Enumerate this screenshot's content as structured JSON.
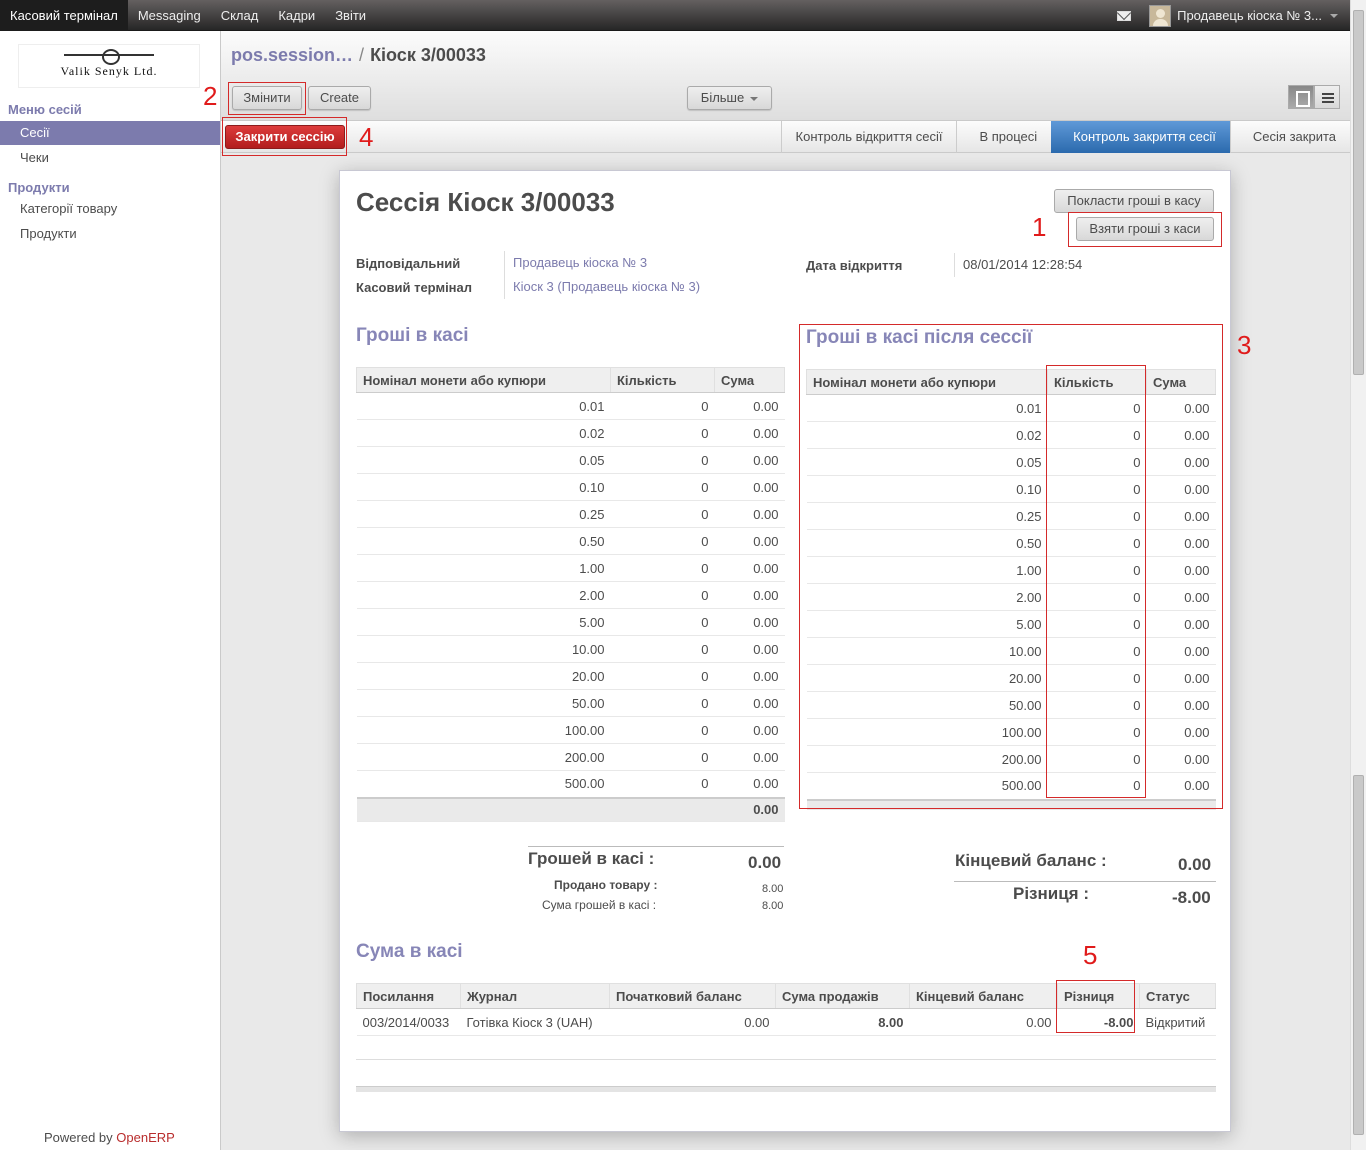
{
  "topbar": {
    "menu": [
      "Касовий термінал",
      "Messaging",
      "Склад",
      "Кадри",
      "Звіти"
    ],
    "user": "Продавець кіоска № 3..."
  },
  "sidebar": {
    "logo_text": "Valik Senyk Ltd.",
    "sessions_head": "Меню сесій",
    "sessions_items": [
      "Сесії",
      "Чеки"
    ],
    "products_head": "Продукти",
    "products_items": [
      "Категорії товару",
      "Продукти"
    ],
    "powered_prefix": "Powered by ",
    "powered_brand": "OpenERP"
  },
  "header": {
    "bc_link": "pos.session…",
    "bc_sep": "/",
    "bc_current": "Кіоск 3/00033",
    "edit_label": "Змінити",
    "create_label": "Create",
    "more_label": "Більше"
  },
  "statusbar": {
    "close_label": "Закрити сессію",
    "stages": [
      "Контроль відкриття сесії",
      "В процесі",
      "Контроль закриття сесії",
      "Сесія закрита"
    ],
    "active_stage": 2
  },
  "sheet": {
    "title": "Сессія Кіоск 3/00033",
    "put_money": "Покласти гроші в касу",
    "take_money": "Взяти гроші з каси",
    "responsible_label": "Відповідальний",
    "responsible_value": "Продавець кіоска № 3",
    "pos_label": "Касовий термінал",
    "pos_value": "Кіоск 3 (Продавець кіоска № 3)",
    "open_date_label": "Дата відкриття",
    "open_date_value": "08/01/2014 12:28:54",
    "cash_title": "Гроші в касі",
    "cash_after_title": "Гроші в касі після сессії",
    "col_denom": "Номінал монети або купюри",
    "col_qty": "Кількість",
    "col_sum": "Сума",
    "denoms": [
      "0.01",
      "0.02",
      "0.05",
      "0.10",
      "0.25",
      "0.50",
      "1.00",
      "2.00",
      "5.00",
      "10.00",
      "20.00",
      "50.00",
      "100.00",
      "200.00",
      "500.00"
    ],
    "qty": "0",
    "sum": "0.00",
    "total": "0.00",
    "money_in_cash_label": "Грошей в касі :",
    "money_in_cash_value": "0.00",
    "sold_label": "Продано товару :",
    "sold_value": "8.00",
    "cash_sum_label": "Сума грошей в касі :",
    "cash_sum_value": "8.00",
    "end_balance_label": "Кінцевий баланс :",
    "end_balance_value": "0.00",
    "diff_label": "Різниця :",
    "diff_value": "-8.00",
    "statement_title": "Сума в касі",
    "st_cols": [
      "Посилання",
      "Журнал",
      "Початковий баланс",
      "Сума продажів",
      "Кінцевий баланс",
      "Різниця",
      "Статус"
    ],
    "st_row": [
      "003/2014/0033",
      "Готівка Кіоск 3 (UAH)",
      "0.00",
      "8.00",
      "0.00",
      "-8.00",
      "Відкритий"
    ]
  },
  "annotations": [
    "1",
    "2",
    "3",
    "4",
    "5"
  ],
  "colors": {
    "accent": "#7c7bad",
    "active_stage": "#3a77b8",
    "danger": "#c0262a",
    "annotation": "#e01b1b"
  }
}
